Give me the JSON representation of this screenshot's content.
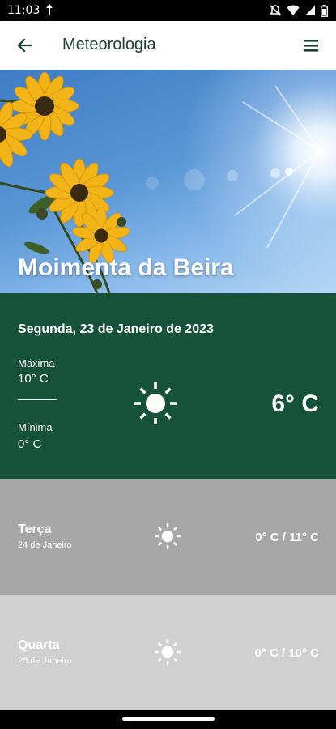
{
  "status_bar": {
    "time": "11:03",
    "icons": [
      "data-arrows-icon",
      "mute-icon",
      "wifi-icon",
      "signal-icon",
      "battery-icon"
    ]
  },
  "app_bar": {
    "title": "Meteorologia",
    "back_icon": "arrow-back-icon",
    "menu_icon": "hamburger-menu-icon"
  },
  "hero": {
    "city": "Moimenta da Beira"
  },
  "today": {
    "date": "Segunda, 23 de Janeiro de 2023",
    "max_label": "Máxima",
    "max_value": "10° C",
    "min_label": "Mínima",
    "min_value": "0° C",
    "current_temp": "6° C",
    "icon": "sun-icon"
  },
  "forecast": [
    {
      "day": "Terça",
      "date": "24 de Janeiro",
      "temps": "0° C / 11° C",
      "icon": "sun-icon"
    },
    {
      "day": "Quarta",
      "date": "25 de Janeiro",
      "temps": "0° C / 10° C",
      "icon": "sun-icon"
    }
  ],
  "colors": {
    "today_bg": "#16513a",
    "row1_bg": "#a6a6a6",
    "row2_bg": "#d0d0d0",
    "title_color": "#1c3f2e"
  }
}
